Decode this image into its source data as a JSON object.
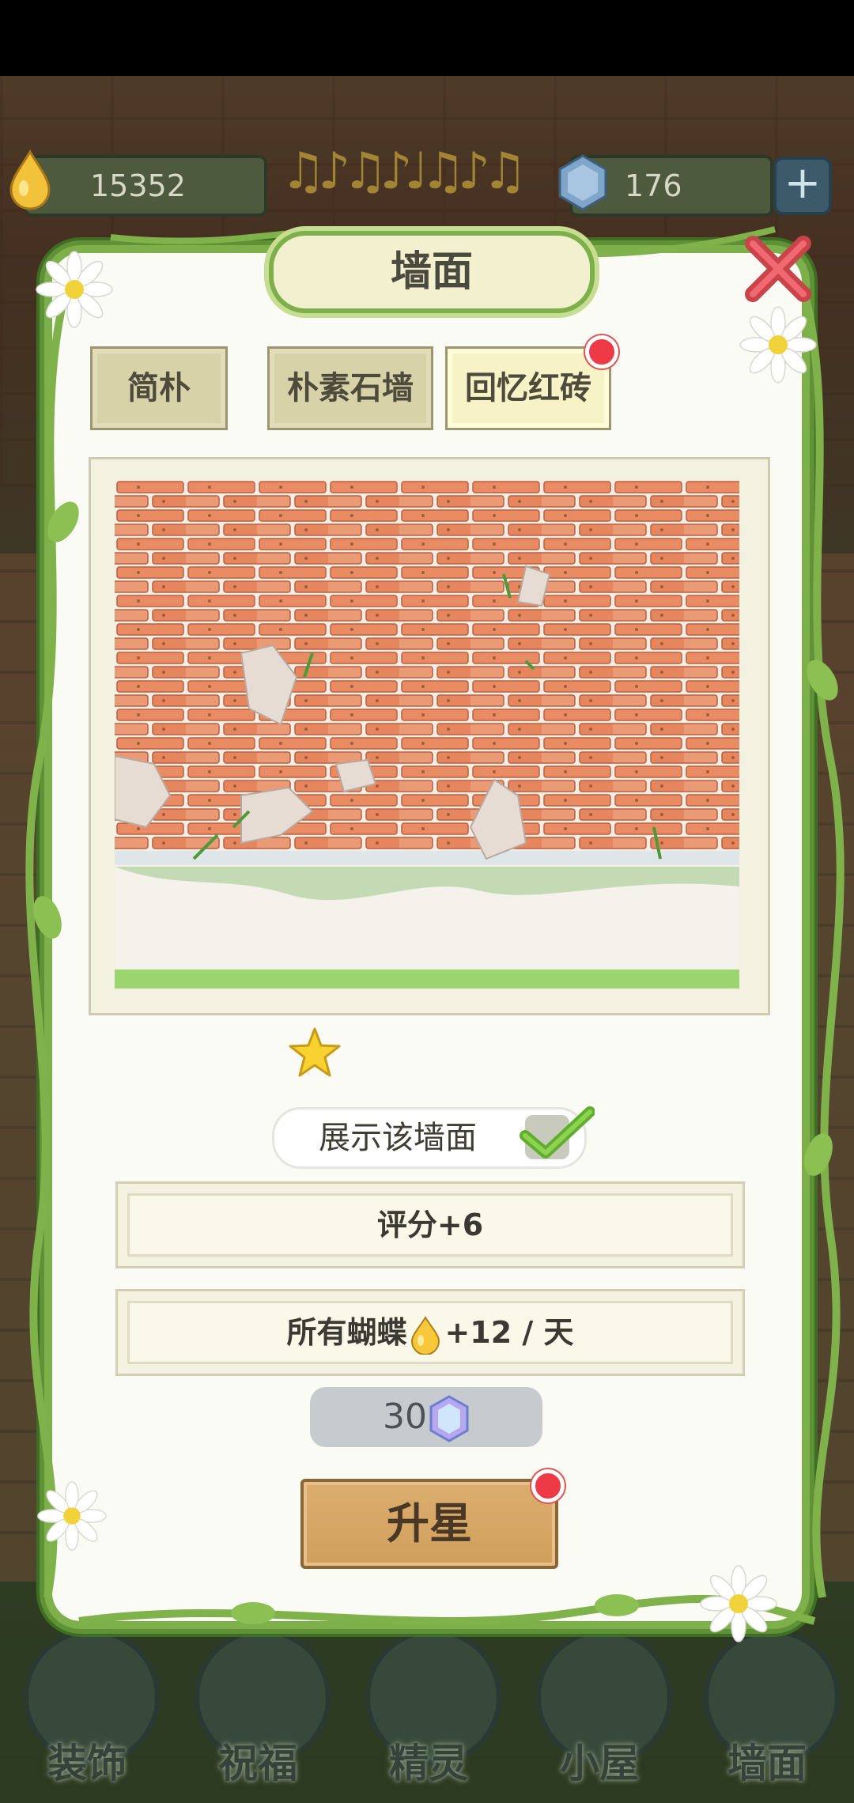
{
  "resources": {
    "honey_amount": "15352",
    "gem_amount": "176",
    "add_button_label": "+"
  },
  "dialog": {
    "title": "墙面",
    "tabs": [
      {
        "label": "简朴",
        "active": false
      },
      {
        "label": "朴素石墙",
        "active": false
      },
      {
        "label": "回忆红砖",
        "active": true,
        "has_notification": true
      }
    ],
    "star_rating": 1,
    "show_wall_label": "展示该墙面",
    "show_wall_checked": true,
    "score_text": "评分+6",
    "butterfly_prefix": "所有蝴蝶",
    "butterfly_suffix": "+12 / 天",
    "cost_value": "30",
    "upgrade_label": "升星",
    "upgrade_has_notification": true
  },
  "bottom_nav": [
    {
      "label": "装饰",
      "icon": "plant-icon"
    },
    {
      "label": "祝福",
      "icon": "butterfly-icon"
    },
    {
      "label": "精灵",
      "icon": "fairy-icon"
    },
    {
      "label": "小屋",
      "icon": "house-icon"
    },
    {
      "label": "墙面",
      "icon": "bell-icon"
    }
  ],
  "colors": {
    "vine_green": "#7db04a",
    "tab_active": "#f7f3c6",
    "notification_red": "#ee3a46",
    "upgrade_button": "#d8a865",
    "brick": "#e48a62",
    "star": "#f7d231"
  }
}
